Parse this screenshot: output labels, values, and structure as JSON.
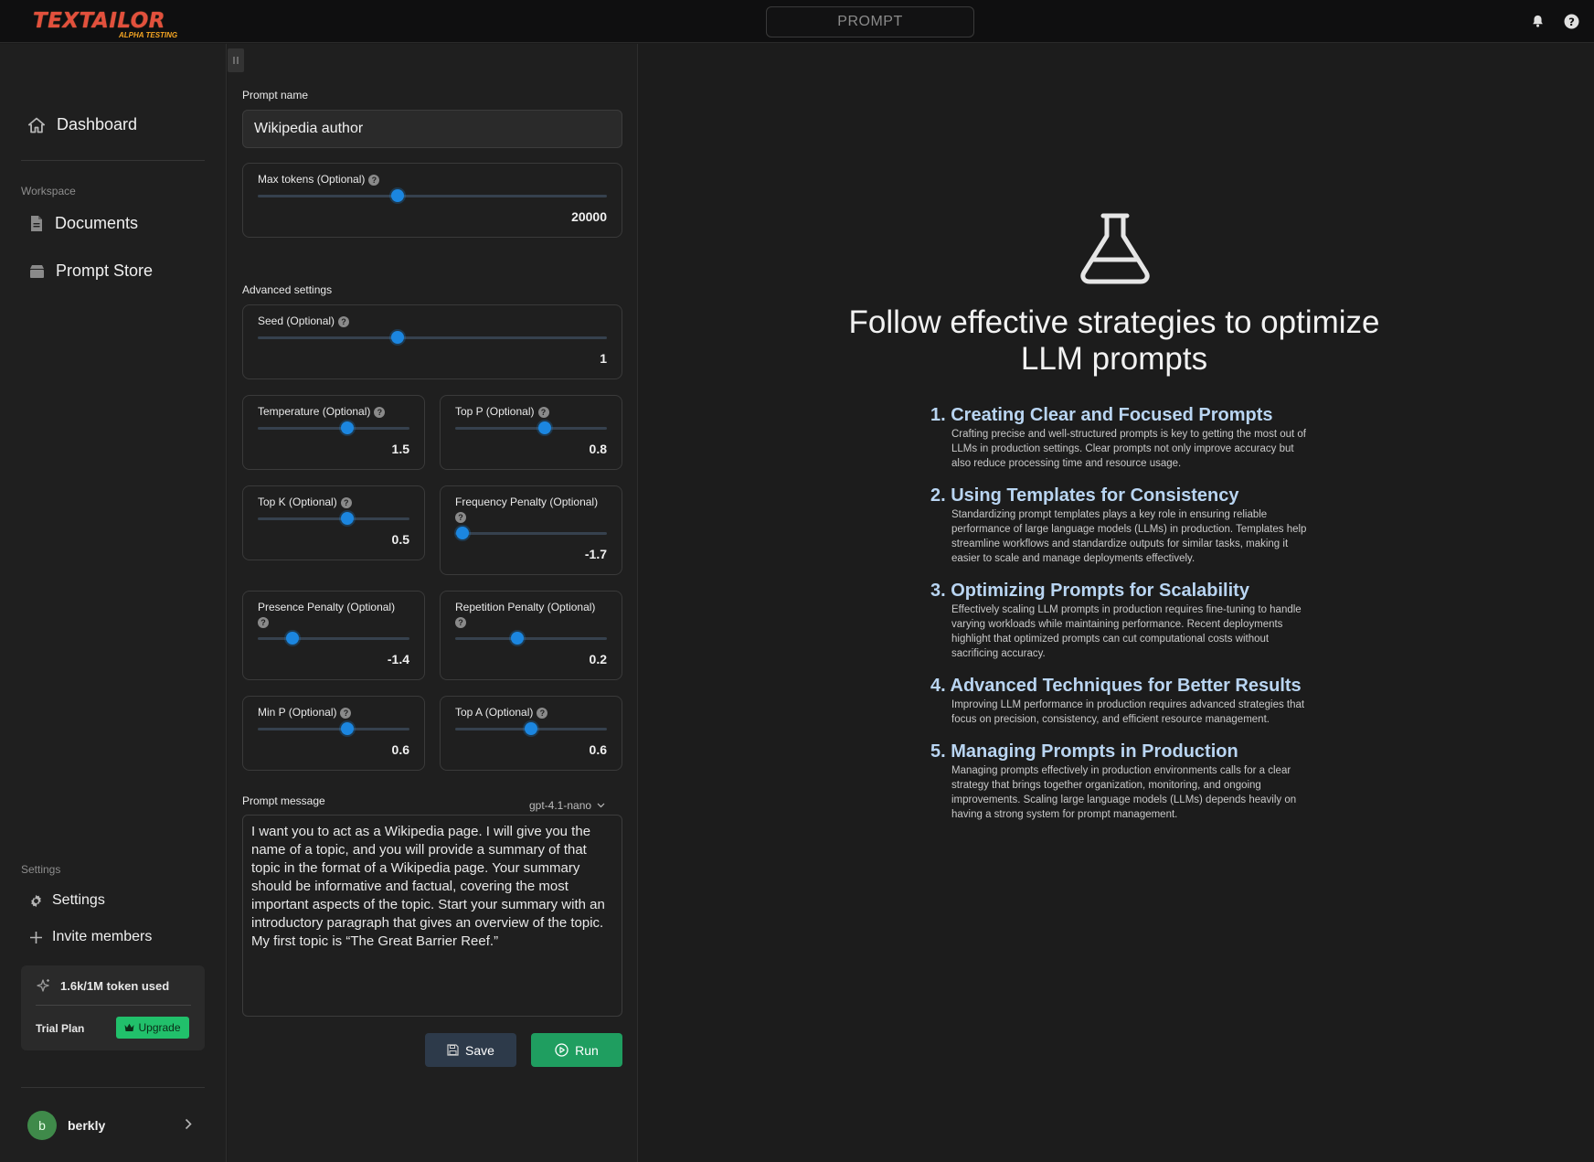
{
  "app": {
    "logo_text": "TEXTAILOR",
    "logo_subtitle": "ALPHA TESTING",
    "page_title": "PROMPT"
  },
  "sidebar": {
    "dashboard": "Dashboard",
    "workspace_label": "Workspace",
    "documents": "Documents",
    "prompt_store": "Prompt Store",
    "settings_label": "Settings",
    "settings": "Settings",
    "invite_members": "Invite members",
    "token_usage": "1.6k/1M token used",
    "plan": "Trial Plan",
    "upgrade": "Upgrade",
    "user_initial": "b",
    "user_name": "berkly"
  },
  "form": {
    "prompt_name_label": "Prompt name",
    "prompt_name_value": "Wikipedia author",
    "max_tokens": {
      "label": "Max tokens (Optional)",
      "value": "20000",
      "fraction": 0.4
    },
    "advanced_label": "Advanced settings",
    "seed": {
      "label": "Seed (Optional)",
      "value": "1",
      "fraction": 0.4
    },
    "temperature": {
      "label": "Temperature (Optional)",
      "value": "1.5",
      "fraction": 0.59
    },
    "top_p": {
      "label": "Top P (Optional)",
      "value": "0.8",
      "fraction": 0.59
    },
    "top_k": {
      "label": "Top K (Optional)",
      "value": "0.5",
      "fraction": 0.59
    },
    "frequency_penalty": {
      "label": "Frequency Penalty (Optional)",
      "value": "-1.7",
      "fraction": 0.05
    },
    "presence_penalty": {
      "label": "Presence Penalty (Optional)",
      "value": "-1.4",
      "fraction": 0.23
    },
    "repetition_penalty": {
      "label": "Repetition Penalty (Optional)",
      "value": "0.2",
      "fraction": 0.41
    },
    "min_p": {
      "label": "Min P (Optional)",
      "value": "0.6",
      "fraction": 0.59
    },
    "top_a": {
      "label": "Top A (Optional)",
      "value": "0.6",
      "fraction": 0.5
    },
    "prompt_message_label": "Prompt message",
    "model": "gpt-4.1-nano",
    "prompt_message": "I want you to act as a Wikipedia page. I will give you the name of a topic, and you will provide a summary of that topic in the format of a Wikipedia page. Your summary should be informative and factual, covering the most important aspects of the topic. Start your summary with an introductory paragraph that gives an overview of the topic. My first topic is “The Great Barrier Reef.”",
    "save_label": "Save",
    "run_label": "Run"
  },
  "tips_panel": {
    "headline": "Follow effective strategies to optimize LLM prompts",
    "tips": [
      {
        "title": "1. Creating Clear and Focused Prompts",
        "body": "Crafting precise and well-structured prompts is key to getting the most out of LLMs in production settings. Clear prompts not only improve accuracy but also reduce processing time and resource usage."
      },
      {
        "title": "2. Using Templates for Consistency",
        "body": "Standardizing prompt templates plays a key role in ensuring reliable performance of large language models (LLMs) in production. Templates help streamline workflows and standardize outputs for similar tasks, making it easier to scale and manage deployments effectively."
      },
      {
        "title": "3. Optimizing Prompts for Scalability",
        "body": "Effectively scaling LLM prompts in production requires fine-tuning to handle varying workloads while maintaining performance. Recent deployments highlight that optimized prompts can cut computational costs without sacrificing accuracy."
      },
      {
        "title": "4. Advanced Techniques for Better Results",
        "body": "Improving LLM performance in production requires advanced strategies that focus on precision, consistency, and efficient resource management."
      },
      {
        "title": "5. Managing Prompts in Production",
        "body": "Managing prompts effectively in production environments calls for a clear strategy that brings together organization, monitoring, and ongoing improvements. Scaling large language models (LLMs) depends heavily on having a strong system for prompt management."
      }
    ]
  },
  "colors": {
    "accent": "#1b86e0",
    "run_button": "#1f9e60",
    "upgrade_button": "#21c06b",
    "tip_title": "#b9d5f2",
    "logo": "#e2503d"
  },
  "icons": [
    "home-icon",
    "document-icon",
    "store-icon",
    "gear-icon",
    "plus-icon",
    "sparkle-icon",
    "crown-icon",
    "chevron-right-icon",
    "bell-icon",
    "help-icon",
    "save-icon",
    "play-icon",
    "flask-icon",
    "chevron-down-icon"
  ]
}
